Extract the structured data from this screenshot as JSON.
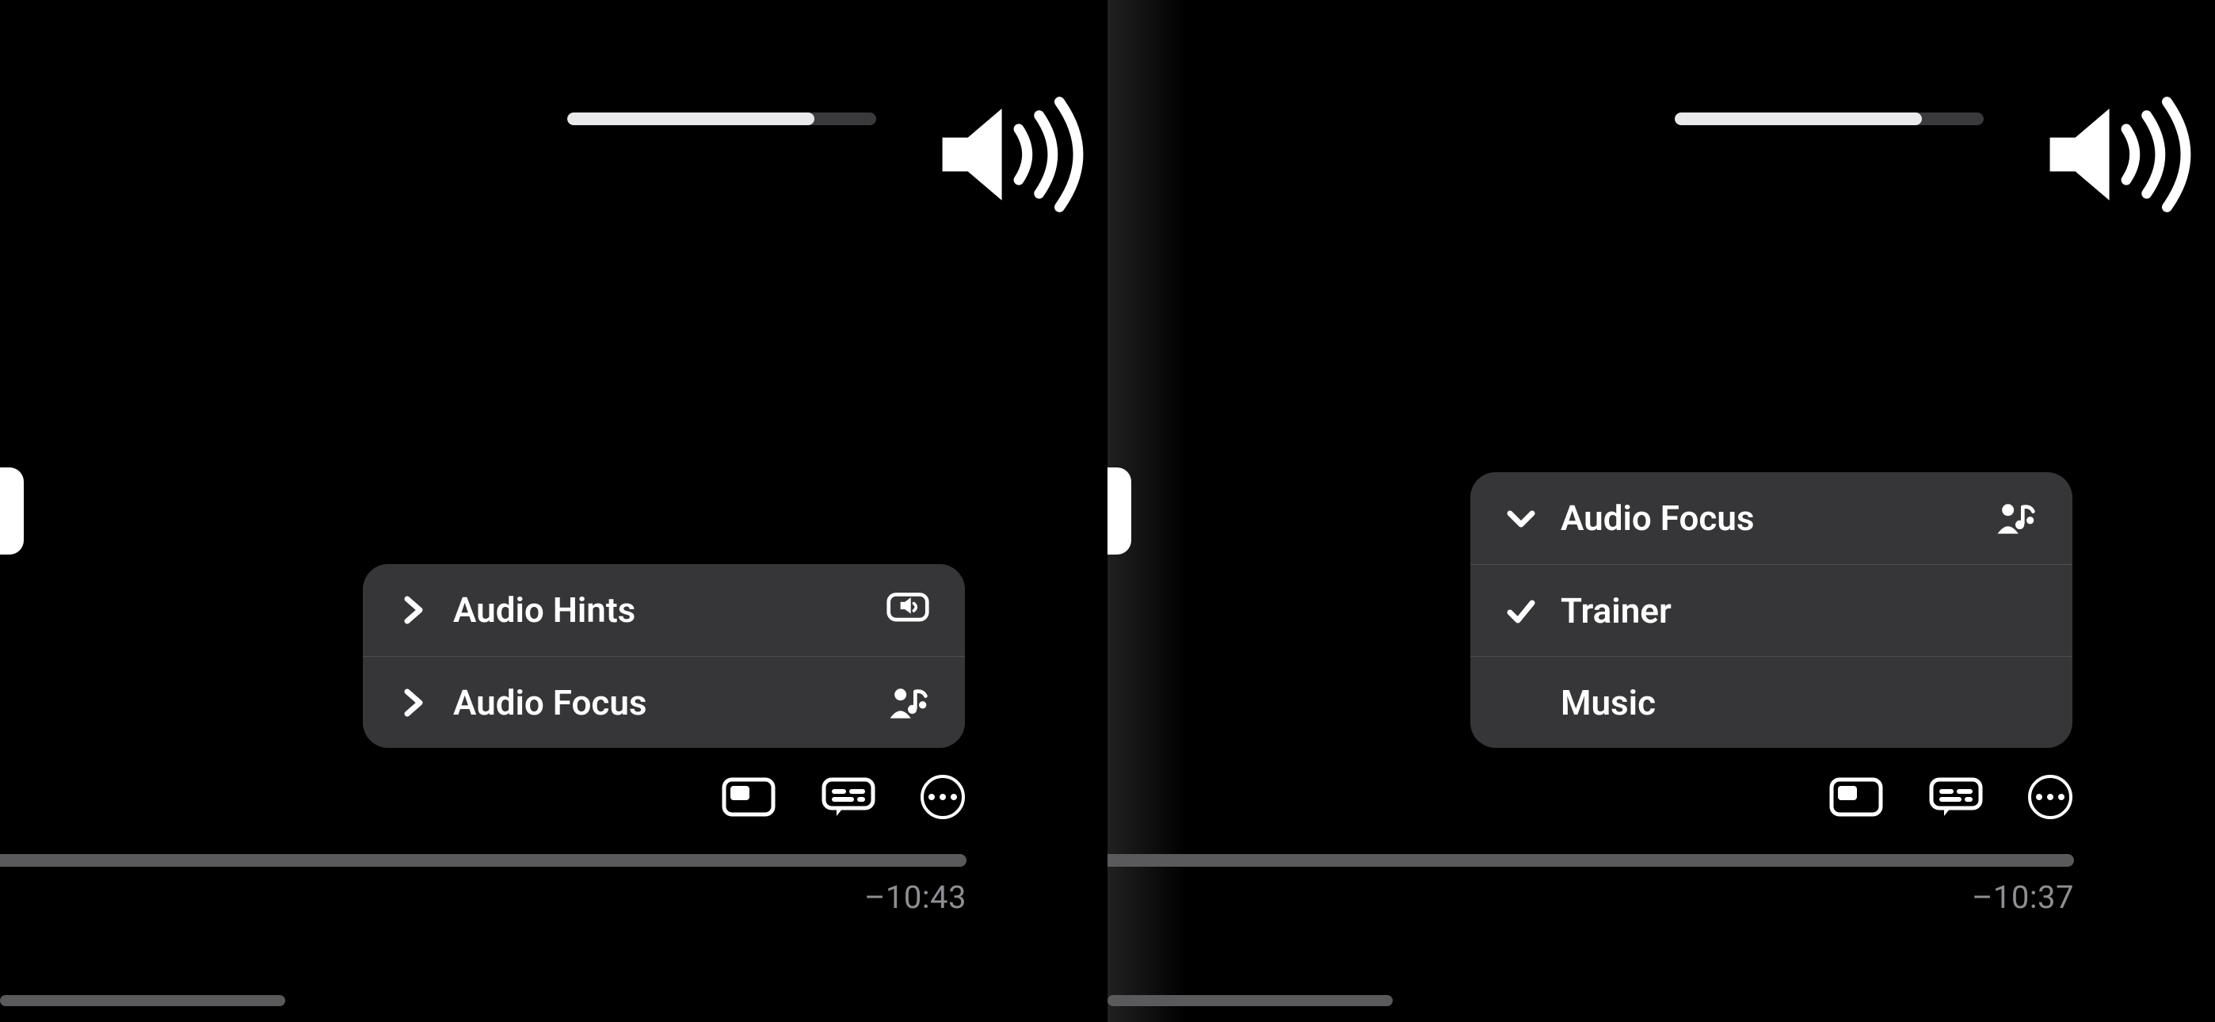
{
  "left": {
    "volume": {
      "percent": 80
    },
    "menu": {
      "items": [
        {
          "label": "Audio Hints",
          "icon": "speech-speaker-icon"
        },
        {
          "label": "Audio Focus",
          "icon": "person-music-icon"
        }
      ]
    },
    "time_remaining": "–10:43"
  },
  "right": {
    "volume": {
      "percent": 80
    },
    "submenu": {
      "title": "Audio Focus",
      "options": [
        {
          "label": "Trainer",
          "selected": true
        },
        {
          "label": "Music",
          "selected": false
        }
      ]
    },
    "time_remaining": "–10:37"
  }
}
